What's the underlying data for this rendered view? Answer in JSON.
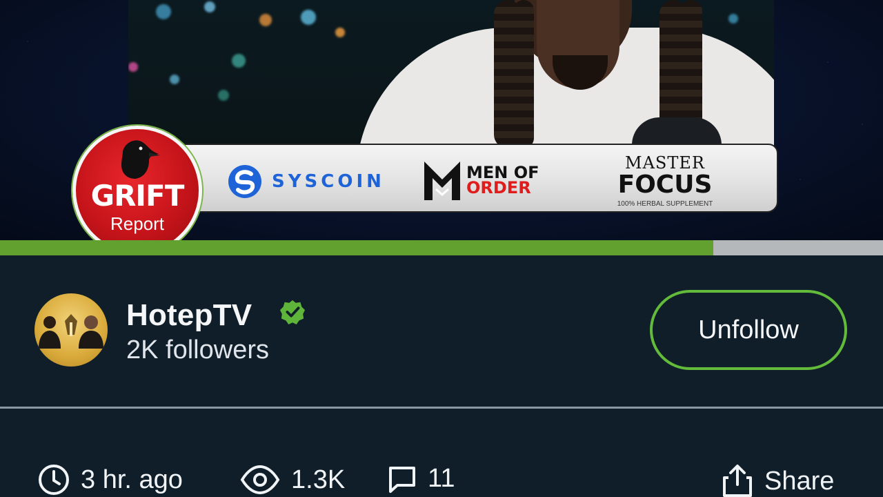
{
  "video": {
    "sponsors": {
      "syscoin": "SYSCOIN",
      "men_of_order_line1": "MEN OF",
      "men_of_order_line2": "ORDER",
      "master_focus_top": "MASTER",
      "master_focus_main": "FOCUS",
      "master_focus_sub": "100% HERBAL SUPPLEMENT"
    },
    "badge": {
      "title": "GRIFT",
      "subtitle": "Report"
    },
    "progress_fraction": 0.808
  },
  "channel": {
    "name": "HotepTV",
    "verified_icon": "verified-check-icon",
    "followers": "2K followers",
    "unfollow_label": "Unfollow"
  },
  "stats": {
    "time": {
      "icon": "clock-icon",
      "label": "3 hr. ago"
    },
    "views": {
      "icon": "eye-icon",
      "label": "1.3K"
    },
    "comments": {
      "icon": "comment-icon",
      "label": "11"
    },
    "share": {
      "icon": "share-icon",
      "label": "Share"
    }
  },
  "colors": {
    "background": "#0f1e29",
    "accent_green": "#62bb3a",
    "progress_green": "#62a02f",
    "syscoin_blue": "#1e64d8",
    "grift_red": "#c5141a"
  }
}
